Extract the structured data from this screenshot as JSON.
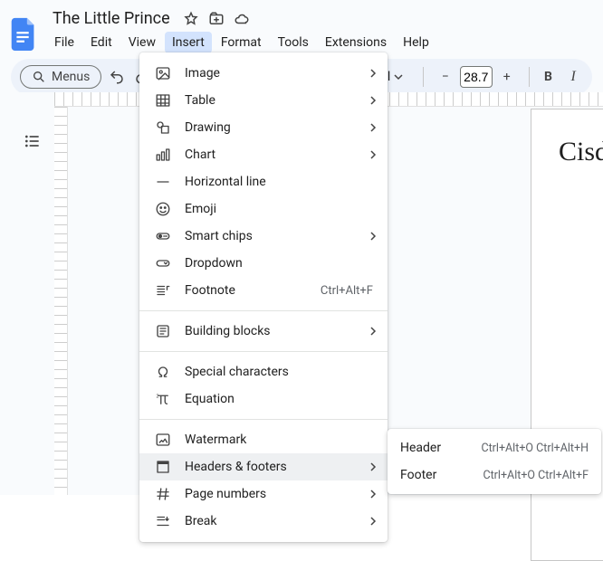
{
  "title": "The Little Prince",
  "menubar": [
    "File",
    "Edit",
    "View",
    "Insert",
    "Format",
    "Tools",
    "Extensions",
    "Help"
  ],
  "active_menu_index": 3,
  "toolbar": {
    "search_label": "Menus",
    "font_name": "Arial",
    "font_size": "28.7",
    "bold": "B",
    "italic": "I",
    "minus": "−",
    "plus": "+"
  },
  "insert_menu": {
    "items": [
      {
        "icon": "image",
        "label": "Image",
        "submenu": true
      },
      {
        "icon": "table",
        "label": "Table",
        "submenu": true
      },
      {
        "icon": "drawing",
        "label": "Drawing",
        "submenu": true
      },
      {
        "icon": "chart",
        "label": "Chart",
        "submenu": true
      },
      {
        "icon": "hr",
        "label": "Horizontal line"
      },
      {
        "icon": "emoji",
        "label": "Emoji"
      },
      {
        "icon": "smartchips",
        "label": "Smart chips",
        "submenu": true
      },
      {
        "icon": "dropdown",
        "label": "Dropdown"
      },
      {
        "icon": "footnote",
        "label": "Footnote",
        "shortcut": "Ctrl+Alt+F"
      },
      {
        "sep": true
      },
      {
        "icon": "blocks",
        "label": "Building blocks",
        "submenu": true
      },
      {
        "sep": true
      },
      {
        "icon": "omega",
        "label": "Special characters"
      },
      {
        "icon": "pi",
        "label": "Equation"
      },
      {
        "sep": true
      },
      {
        "icon": "watermark",
        "label": "Watermark"
      },
      {
        "icon": "headers",
        "label": "Headers & footers",
        "submenu": true,
        "highlight": true
      },
      {
        "icon": "hash",
        "label": "Page numbers",
        "submenu": true
      },
      {
        "icon": "break",
        "label": "Break",
        "submenu": true
      }
    ]
  },
  "submenu_headers_footers": [
    {
      "label": "Header",
      "shortcut": "Ctrl+Alt+O Ctrl+Alt+H"
    },
    {
      "label": "Footer",
      "shortcut": "Ctrl+Alt+O Ctrl+Alt+F"
    }
  ],
  "page_text": "Cisden"
}
